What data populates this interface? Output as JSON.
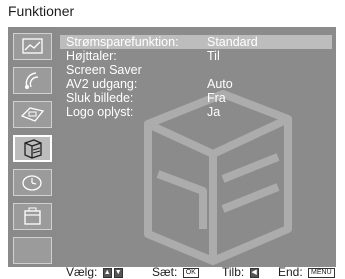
{
  "title": "Funktioner",
  "sidebar": {
    "items": [
      {
        "icon": "picture-icon"
      },
      {
        "icon": "sound-icon"
      },
      {
        "icon": "screen-icon"
      },
      {
        "icon": "features-icon",
        "active": true
      },
      {
        "icon": "clock-icon"
      },
      {
        "icon": "setup-icon"
      },
      {
        "icon": "blank"
      }
    ]
  },
  "menu": {
    "rows": [
      {
        "label": "Strømsparefunktion:",
        "value": "Standard"
      },
      {
        "label": "Højttaler:",
        "value": "Til"
      },
      {
        "label": "Screen Saver",
        "value": ""
      },
      {
        "label": "AV2 udgang:",
        "value": "Auto"
      },
      {
        "label": "Sluk billede:",
        "value": "Fra"
      },
      {
        "label": "Logo oplyst:",
        "value": "Ja"
      }
    ]
  },
  "footer": {
    "select_label": "Vælg:",
    "set_label": "Sæt:",
    "set_key": "OK",
    "back_label": "Tilb:",
    "end_label": "End:",
    "end_key": "MENU"
  },
  "colors": {
    "panel": "#8b8b8b",
    "highlight": "#bdbdbd",
    "text": "#ffffff"
  }
}
